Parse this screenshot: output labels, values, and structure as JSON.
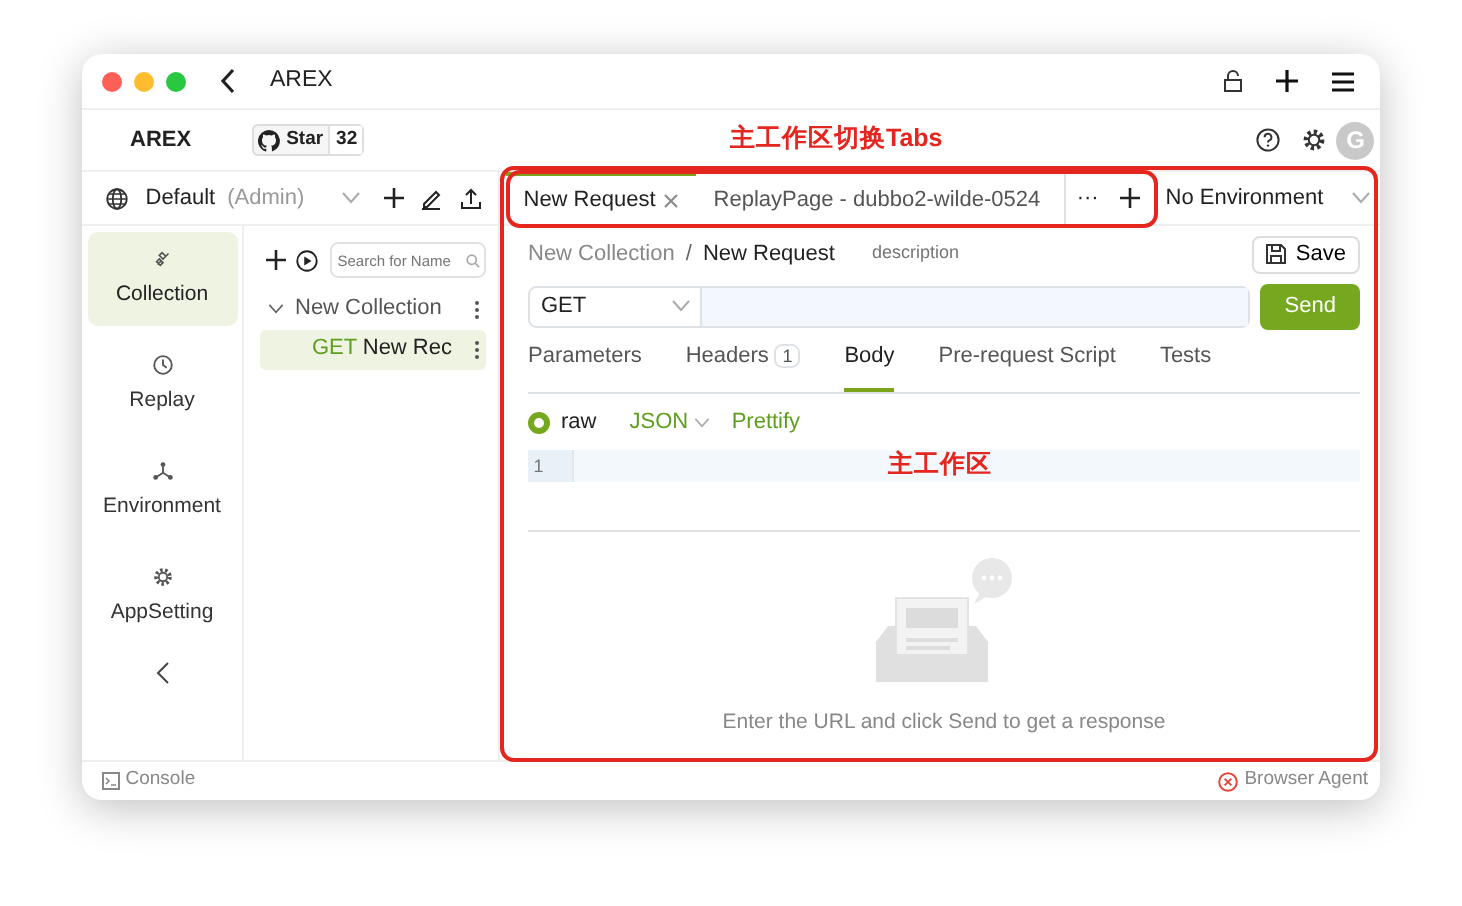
{
  "window": {
    "title": "AREX"
  },
  "header": {
    "app_name": "AREX",
    "github": {
      "label": "Star",
      "count": "32"
    },
    "avatar": "G"
  },
  "workspace": {
    "name": "Default",
    "role": "(Admin)"
  },
  "tabs": [
    {
      "label": "New Request",
      "selected": true,
      "closable": true
    },
    {
      "label": "ReplayPage - dubbo2-wilde-0524",
      "selected": false,
      "closable": false
    }
  ],
  "tab_more": "···",
  "environment": {
    "value": "No Environment"
  },
  "nav": [
    {
      "label": "Collection",
      "selected": true
    },
    {
      "label": "Replay",
      "selected": false
    },
    {
      "label": "Environment",
      "selected": false
    },
    {
      "label": "AppSetting",
      "selected": false
    }
  ],
  "tree": {
    "search_placeholder": "Search for Name",
    "items": [
      {
        "label": "New Collection",
        "expanded": true,
        "children": [
          {
            "method": "GET",
            "label": "New Rec",
            "selected": true
          }
        ]
      }
    ]
  },
  "request": {
    "breadcrumb": {
      "parent": "New Collection",
      "separator": "/",
      "current": "New Request"
    },
    "description_placeholder": "description",
    "save": "Save",
    "method": "GET",
    "send": "Send"
  },
  "request_tabs": [
    {
      "label": "Parameters",
      "selected": false
    },
    {
      "label": "Headers",
      "badge": "1",
      "selected": false
    },
    {
      "label": "Body",
      "selected": true
    },
    {
      "label": "Pre-request Script",
      "selected": false
    },
    {
      "label": "Tests",
      "selected": false
    }
  ],
  "body": {
    "mode": {
      "label": "raw",
      "checked": true
    },
    "format": "JSON",
    "prettify": "Prettify",
    "line_numbers": [
      "1"
    ]
  },
  "response": {
    "empty_message": "Enter the URL and click Send to get a response"
  },
  "status_bar": {
    "console": "Console",
    "agent": "Browser Agent"
  },
  "annotations": [
    {
      "text": "主工作区切换Tabs",
      "kind": "tabs"
    },
    {
      "text": "主工作区",
      "kind": "workspace"
    }
  ]
}
